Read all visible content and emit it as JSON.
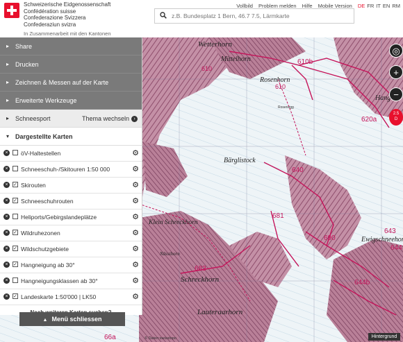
{
  "header": {
    "org_lines": [
      "Schweizerische Eidgenossenschaft",
      "Confédération suisse",
      "Confederazione Svizzera",
      "Confederaziun svizra"
    ],
    "cooperation": "In Zusammenarbeit mit den Kantonen",
    "search_placeholder": "z.B. Bundesplatz 1 Bern, 46.7 7.5, Lärmkarte",
    "links": [
      "Vollbild",
      "Problem melden",
      "Hilfe",
      "Mobile Version"
    ],
    "languages": [
      "DE",
      "FR",
      "IT",
      "EN",
      "RM"
    ],
    "active_language": "DE"
  },
  "panel": {
    "share": "Share",
    "print": "Drucken",
    "draw": "Zeichnen & Messen auf der Karte",
    "tools": "Erweiterte Werkzeuge",
    "theme": "Schneesport",
    "theme_switch": "Thema wechseln",
    "maps_head": "Dargestellte Karten",
    "layers": [
      {
        "label": "öV-Haltestellen",
        "checked": false
      },
      {
        "label": "Schneeschuh-/Skitouren 1:50 000",
        "checked": false
      },
      {
        "label": "Skirouten",
        "checked": true
      },
      {
        "label": "Schneeschuhrouten",
        "checked": true
      },
      {
        "label": "Heliports/Gebirgslandeplätze",
        "checked": false
      },
      {
        "label": "Wildruhezonen",
        "checked": true
      },
      {
        "label": "Wildschutzgebiete",
        "checked": true
      },
      {
        "label": "Hangneigung ab 30°",
        "checked": true
      },
      {
        "label": "Hangneigungsklassen ab 30°",
        "checked": false
      },
      {
        "label": "Landeskarte 1:50'000 | LK50",
        "checked": true
      }
    ],
    "more_maps": "Nach weiteren Karten suchen?",
    "close_menu": "Menü schliessen"
  },
  "map": {
    "labels": [
      {
        "text": "Wetterhorn",
        "kind": "peak"
      },
      {
        "text": "Mittelhorn",
        "kind": "peak"
      },
      {
        "text": "Rosenhorn",
        "kind": "peak"
      },
      {
        "text": "Rosenegg",
        "kind": "peak"
      },
      {
        "text": "Bärglistock",
        "kind": "peak"
      },
      {
        "text": "Klein Schreckhorn",
        "kind": "peak"
      },
      {
        "text": "Nässihorn",
        "kind": "peak"
      },
      {
        "text": "Schreckhorn",
        "kind": "peak"
      },
      {
        "text": "Lauteraarhorn",
        "kind": "peak"
      },
      {
        "text": "Ewigschneehorn",
        "kind": "peak"
      },
      {
        "text": "Hang",
        "kind": "peak"
      },
      {
        "text": "610b",
        "kind": "route"
      },
      {
        "text": "610",
        "kind": "route"
      },
      {
        "text": "610",
        "kind": "route"
      },
      {
        "text": "620a",
        "kind": "route"
      },
      {
        "text": "640",
        "kind": "route"
      },
      {
        "text": "681",
        "kind": "route"
      },
      {
        "text": "690",
        "kind": "route"
      },
      {
        "text": "683",
        "kind": "route"
      },
      {
        "text": "643",
        "kind": "route"
      },
      {
        "text": "644",
        "kind": "route"
      },
      {
        "text": "644b",
        "kind": "route"
      },
      {
        "text": "66a",
        "kind": "route"
      }
    ],
    "background_button": "Hintergrund",
    "copyright": "© Daten:swisstopo"
  },
  "colors": {
    "relief": "#b07890",
    "route": "#c4145a",
    "glacier": "#eef4f6",
    "panel_dark": "#7a7a7a",
    "brand_red": "#e8102d"
  }
}
